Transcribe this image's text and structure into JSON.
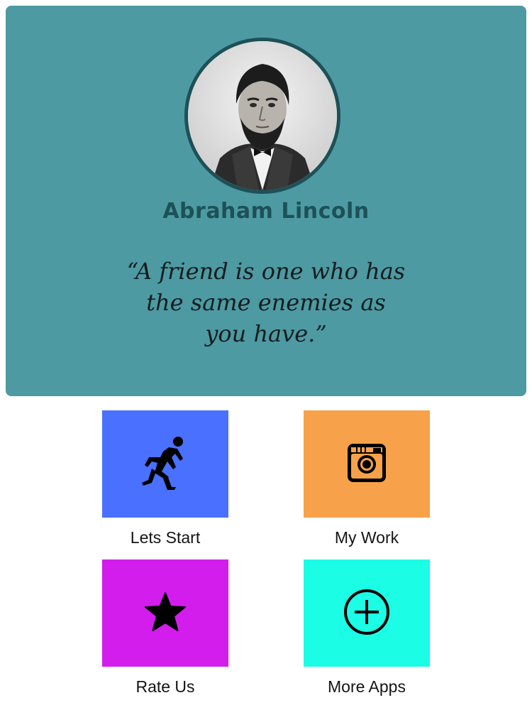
{
  "hero": {
    "author_name": "Abraham Lincoln",
    "quote_line1": "“A friend is one who has",
    "quote_line2": "the same enemies as",
    "quote_line3": "you have.”",
    "background_color": "#4d9aa3",
    "accent_color": "#1d5157"
  },
  "tiles": [
    {
      "label": "Lets Start",
      "icon": "runner-icon",
      "color": "#4a70ff"
    },
    {
      "label": "My Work",
      "icon": "camera-icon",
      "color": "#f7a24a"
    },
    {
      "label": "Rate Us",
      "icon": "star-icon",
      "color": "#d21ded"
    },
    {
      "label": "More Apps",
      "icon": "plus-circle-icon",
      "color": "#1cfde6"
    }
  ]
}
